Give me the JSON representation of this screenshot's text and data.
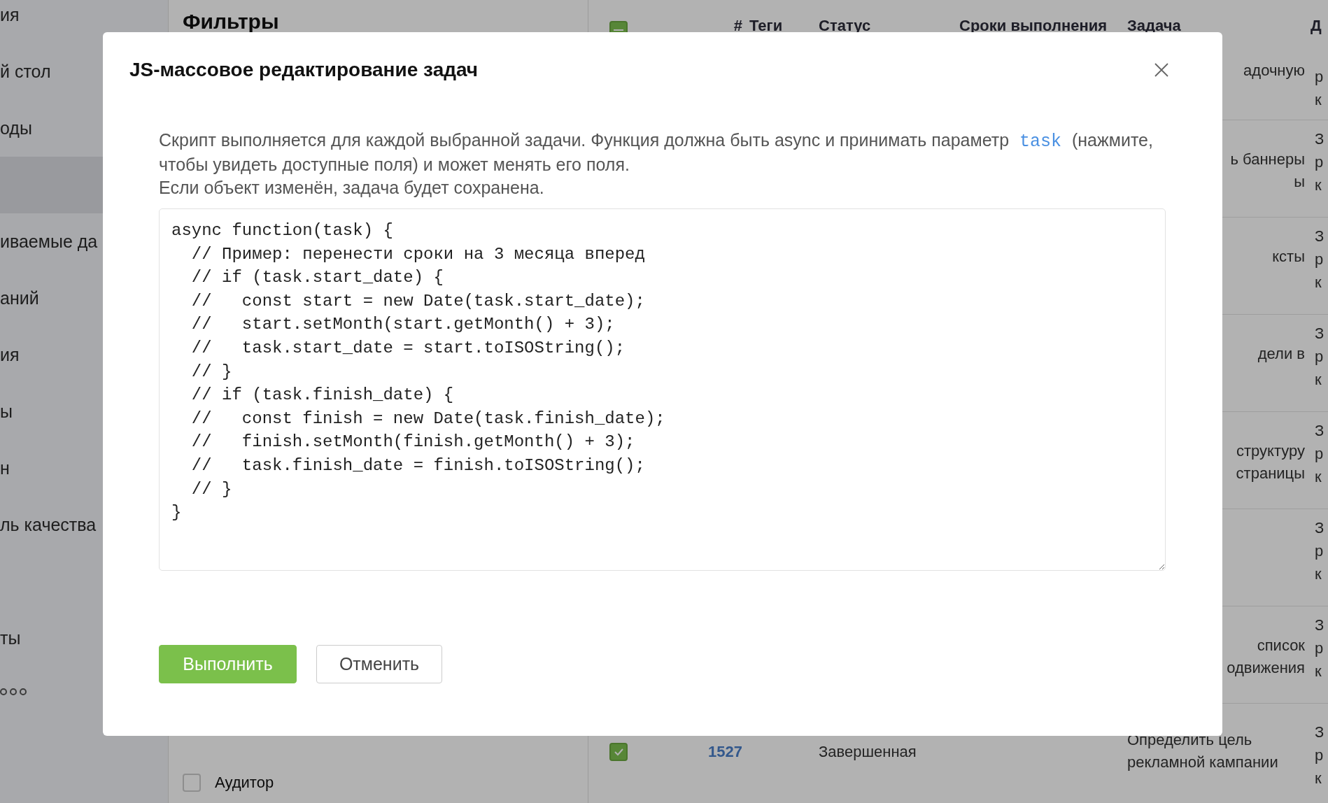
{
  "sidebar": {
    "items": [
      {
        "label": "ия",
        "selected": false
      },
      {
        "label": "й стол",
        "selected": false
      },
      {
        "label": "оды",
        "selected": false
      },
      {
        "selected": true
      },
      {
        "label": "иваемые да",
        "selected": false
      },
      {
        "label": "аний",
        "selected": false
      },
      {
        "label": "ия",
        "selected": false
      },
      {
        "label": "ы",
        "selected": false
      },
      {
        "label": "н",
        "selected": false
      },
      {
        "label": "ль качества",
        "selected": false
      },
      {
        "selected": false
      },
      {
        "label": "ты",
        "selected": false
      }
    ]
  },
  "filters": {
    "title": "Фильтры",
    "options": [
      {
        "label": "Аудитор",
        "checked": false
      }
    ]
  },
  "table": {
    "select_all": {
      "indeterminate": true
    },
    "columns": [
      "#",
      "Теги",
      "Статус",
      "Сроки выполнения",
      "Задача",
      "Д"
    ],
    "rows": [
      {
        "task": [
          "адочную"
        ],
        "column_7": [
          "р",
          "к"
        ]
      },
      {
        "task": [
          "ь баннеры",
          "ы"
        ],
        "column_7": [
          "З",
          "р",
          "к"
        ]
      },
      {
        "task": [
          "ксты"
        ],
        "column_7": [
          "З",
          "р",
          "к"
        ]
      },
      {
        "task": [
          "дели в"
        ],
        "column_7": [
          "З",
          "р",
          "к"
        ]
      },
      {
        "task": [
          "структуру",
          "страницы"
        ],
        "column_7": [
          "З",
          "р",
          "к"
        ]
      },
      {
        "column_7": [
          "З",
          "р",
          "к"
        ]
      },
      {
        "task": [
          "список",
          "одвижения"
        ],
        "column_7": [
          "З",
          "р",
          "к"
        ]
      },
      {
        "checked": true,
        "number": "1527",
        "status": "Завершенная",
        "task": [
          "Определить цель",
          "рекламной кампании"
        ],
        "column_7": [
          "З",
          "р",
          "к"
        ]
      }
    ]
  },
  "dialog": {
    "title": "JS-массовое редактирование задач",
    "description": {
      "before": "Скрипт выполняется для каждой выбранной задачи. Функция должна быть async и принимать параметр ",
      "link": "task",
      "after": " (нажмите, чтобы увидеть доступные поля) и может менять его поля."
    },
    "note": "Если объект изменён, задача будет сохранена.",
    "code": [
      "async function(task) {",
      "  // Пример: перенести сроки на 3 месяца вперед",
      "  // if (task.start_date) {",
      "  //   const start = new Date(task.start_date);",
      "  //   start.setMonth(start.getMonth() + 3);",
      "  //   task.start_date = start.toISOString();",
      "  // }",
      "  // if (task.finish_date) {",
      "  //   const finish = new Date(task.finish_date);",
      "  //   finish.setMonth(finish.getMonth() + 3);",
      "  //   task.finish_date = finish.toISOString();",
      "  // }",
      "}"
    ],
    "buttons": [
      {
        "label": "Выполнить",
        "kind": "primary"
      },
      {
        "label": "Отменить",
        "kind": "secondary"
      }
    ]
  }
}
